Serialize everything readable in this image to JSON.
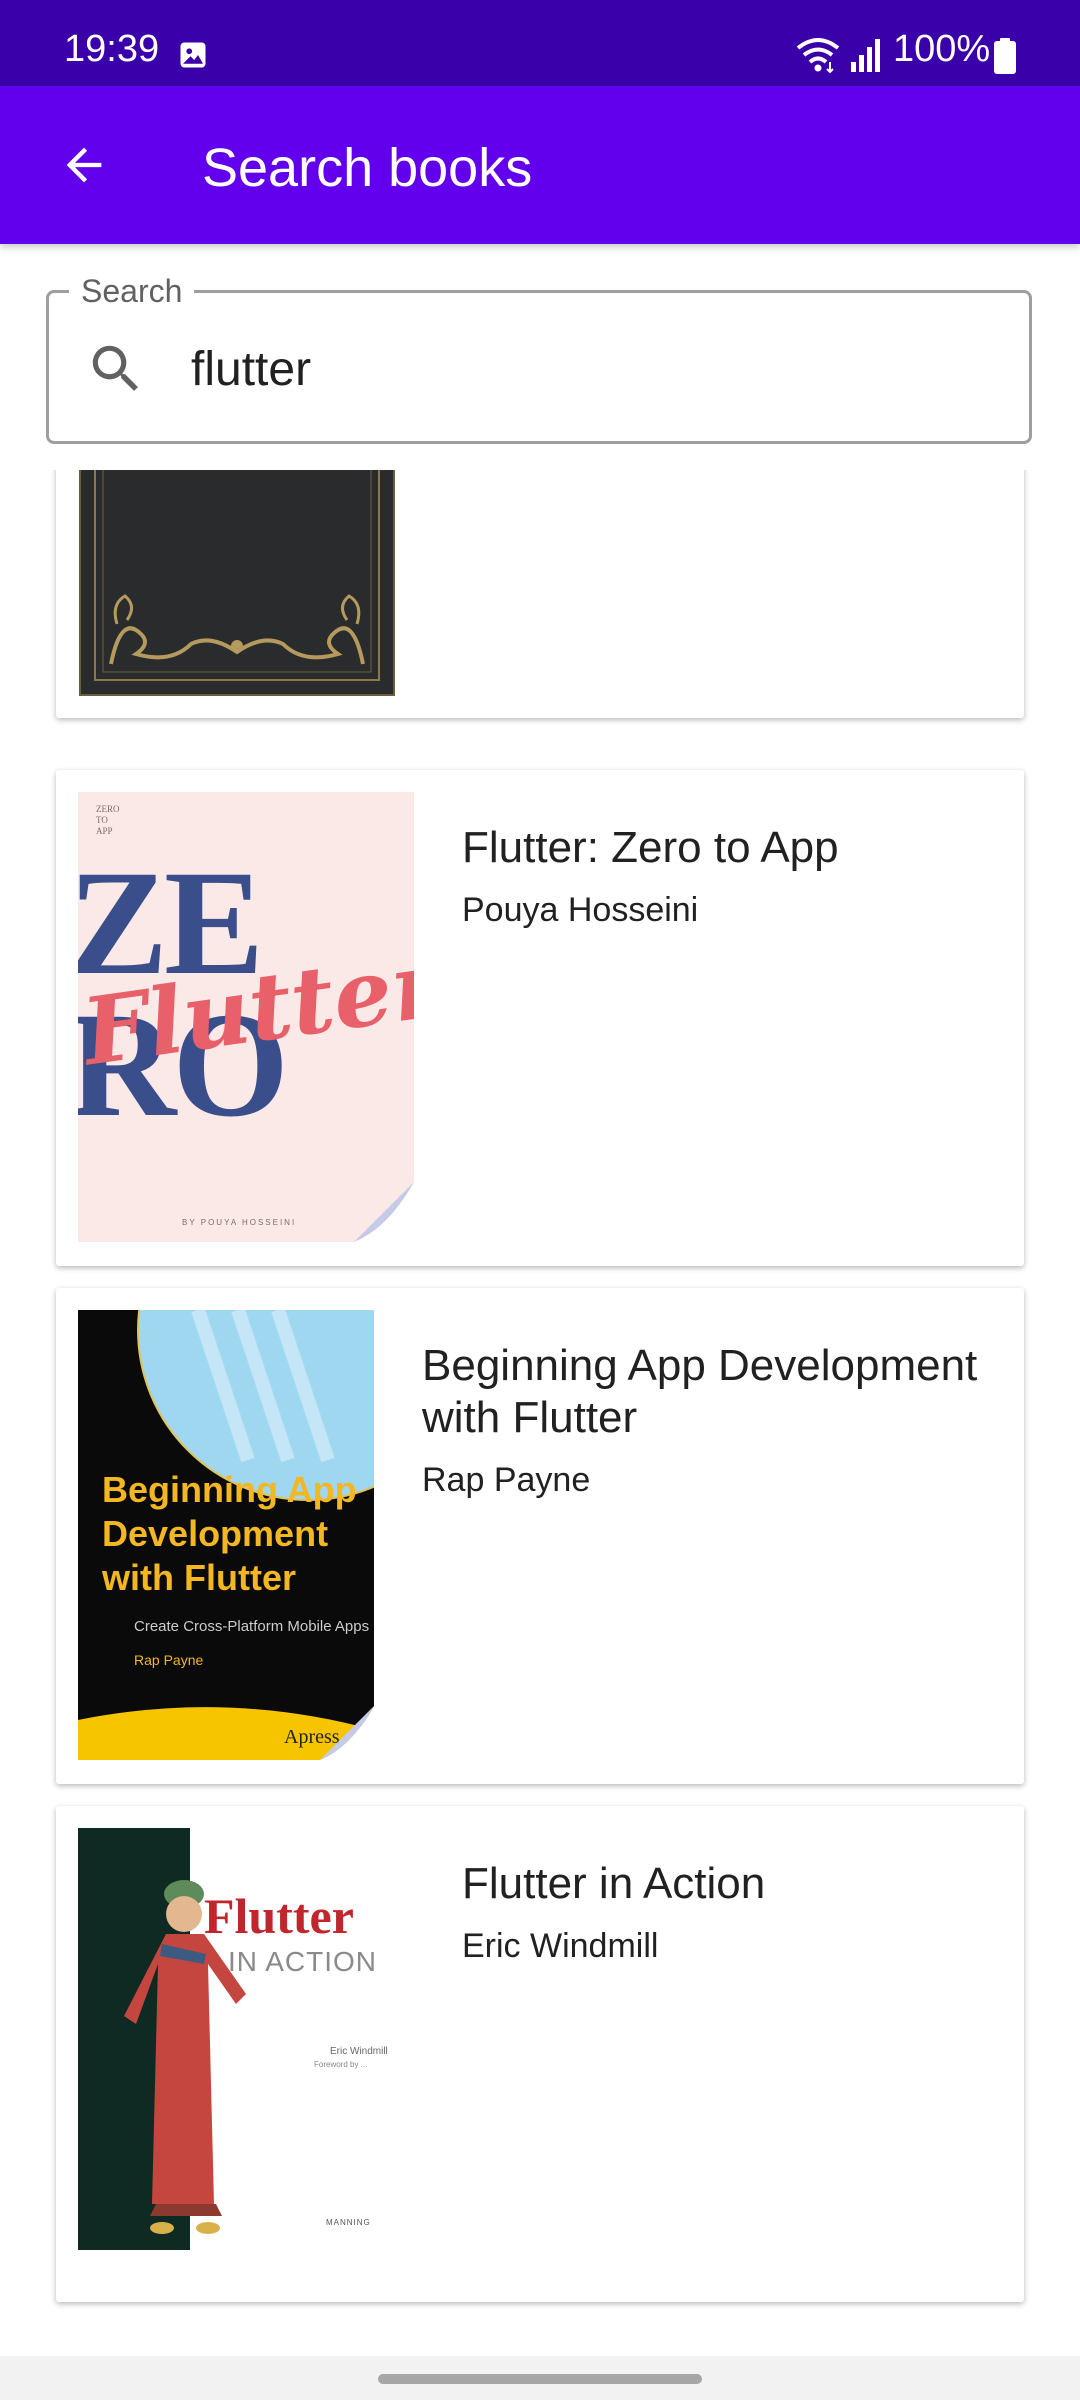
{
  "status_bar": {
    "time": "19:39",
    "battery": "100%",
    "icons": [
      "gallery-icon",
      "wifi-icon",
      "signal-icon",
      "battery-icon"
    ]
  },
  "app_bar": {
    "title": "Search books",
    "back_icon": "arrow-back-icon",
    "color": "#6200EE"
  },
  "search": {
    "label": "Search",
    "value": "flutter",
    "icon": "search-icon"
  },
  "books": [
    {
      "title": "",
      "author": "",
      "cover": "ornate-dark-cover"
    },
    {
      "title": "Flutter: Zero to App",
      "author": "Pouya Hosseini",
      "cover": "zero-to-app-cover"
    },
    {
      "title": "Beginning App Development with Flutter",
      "author": "Rap Payne",
      "cover": "beginning-app-dev-cover"
    },
    {
      "title": "Flutter in Action",
      "author": "Eric Windmill",
      "cover": "flutter-in-action-cover"
    }
  ],
  "covers": {
    "zero": {
      "small": "ZERO\nTO\nAPP",
      "big1": "ZE",
      "big2": "RO",
      "script": "Flutter",
      "byline": "BY POUYA HOSSEINI"
    },
    "beginning": {
      "line1": "Beginning App",
      "line2": "Development",
      "line3": "with Flutter",
      "subtitle": "Create Cross-Platform Mobile Apps",
      "author": "Rap Payne",
      "publisher": "Apress"
    },
    "action": {
      "word1": "Flutter",
      "word2": "IN ACTION",
      "author": "Eric Windmill",
      "foreword": "Foreword by ...",
      "publisher": "MANNING"
    }
  }
}
